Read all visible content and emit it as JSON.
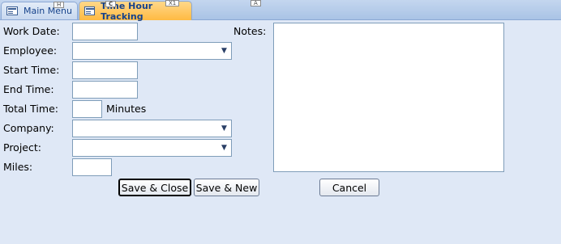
{
  "tabs": [
    {
      "label": "Main Menu",
      "keytip": "H"
    },
    {
      "label": "Time Hour Tracking",
      "keytip": "C"
    }
  ],
  "extra_keytips": [
    "X1",
    "A"
  ],
  "form": {
    "work_date_label": "Work Date:",
    "employee_label": "Employee:",
    "start_time_label": "Start Time:",
    "end_time_label": "End Time:",
    "total_time_label": "Total Time:",
    "minutes_label": "Minutes",
    "company_label": "Company:",
    "project_label": "Project:",
    "miles_label": "Miles:",
    "notes_label": "Notes:"
  },
  "buttons": {
    "save_close": "Save & Close",
    "save_new": "Save & New",
    "cancel": "Cancel"
  },
  "icons": {
    "form_tab": "form-icon",
    "dropdown": "chevron-down-icon"
  }
}
